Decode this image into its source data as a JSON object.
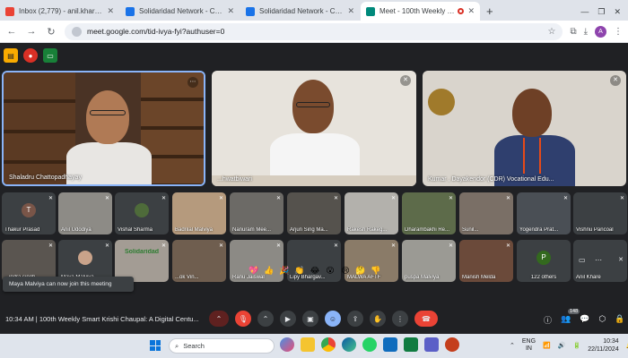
{
  "browser": {
    "tabs": [
      {
        "title": "Inbox (2,779) - anil.khare@soli",
        "color": "#ea4335",
        "active": false
      },
      {
        "title": "Solidaridad Network - Calenda",
        "color": "#1a73e8",
        "active": false
      },
      {
        "title": "Solidaridad Network - Calenda",
        "color": "#1a73e8",
        "active": false
      },
      {
        "title": "Meet - 100th Weekly Smart",
        "color": "#00897b",
        "active": true
      }
    ],
    "new_tab": "+",
    "url": "meet.google.com/tid-ivya-fyi?authuser=0",
    "profile_initial": "A"
  },
  "meet": {
    "main_tiles": [
      {
        "name": "Shaladru Chattopadhayay"
      },
      {
        "name": "...hwatbiwari"
      },
      {
        "name": "Kumar , Dayakendor (CDR) Vocational Edu..."
      }
    ],
    "grid": [
      {
        "name": "Thakur Prasad",
        "avatar": "T",
        "avatar_color": "#795548"
      },
      {
        "name": "Anil Udodiya"
      },
      {
        "name": "Vishal Sharma"
      },
      {
        "name": "Badrilal Malviya"
      },
      {
        "name": "Nanuram Mee..."
      },
      {
        "name": "Arjun Sing Ma..."
      },
      {
        "name": "Rakesh Rakeg..."
      },
      {
        "name": "Dharambakhi Re..."
      },
      {
        "name": "Sunil..."
      },
      {
        "name": "Yogendra Prat..."
      },
      {
        "name": "Vishnu Pancoal"
      },
      {
        "name": "...indra singh"
      },
      {
        "name": "Maya Malviya"
      },
      {
        "name": "Solidaridad"
      },
      {
        "name": "...ok Vin..."
      },
      {
        "name": "Ranu Jaiswal"
      },
      {
        "name": "Lipy Bhargav..."
      },
      {
        "name": "MALWA AFTF"
      },
      {
        "name": "puspa Malviya"
      },
      {
        "name": "Manish Melda"
      },
      {
        "name": "122 others",
        "avatar": "P",
        "avatar_color": "#33691e"
      },
      {
        "name": "Anil Khare"
      }
    ],
    "toast": "Maya Malviya can now join this meeting",
    "reactions": [
      "💖",
      "👍",
      "🎉",
      "👏",
      "😂",
      "😮",
      "😢",
      "🤔",
      "👎"
    ],
    "time": "10:34 AM",
    "meeting_title": "100th Weekly Smart Krishi Chaupal: A Digital Centu...",
    "participant_count": "148"
  },
  "taskbar": {
    "search_placeholder": "Search",
    "lang_top": "ENG",
    "lang_bottom": "IN",
    "clock_time": "10:34",
    "clock_date": "22/11/2024"
  }
}
